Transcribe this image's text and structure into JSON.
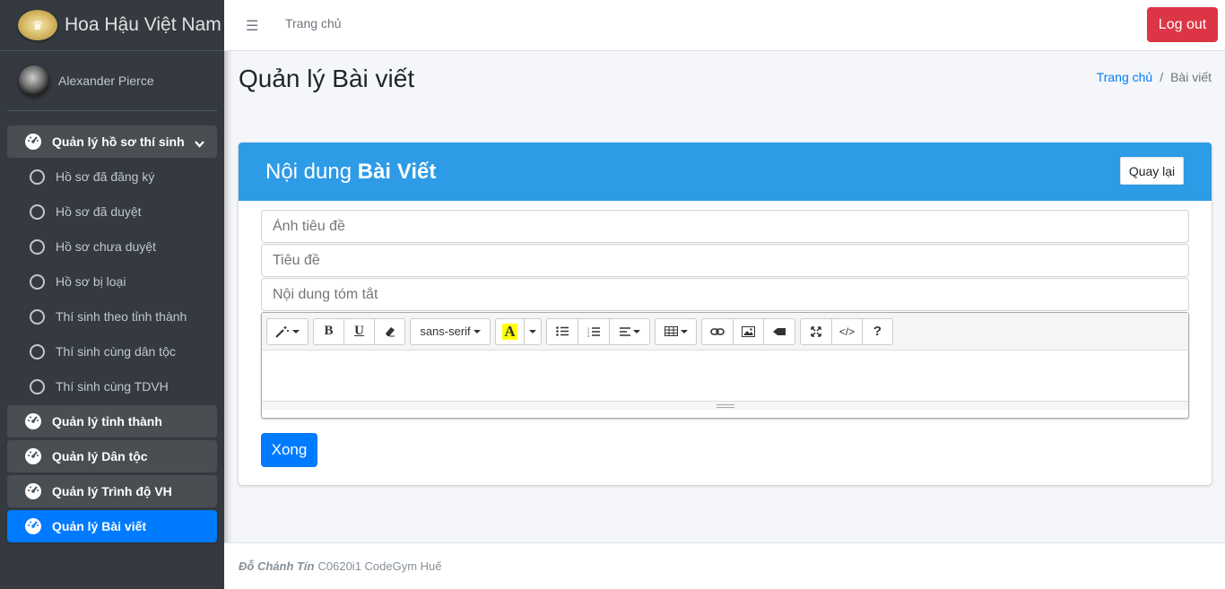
{
  "brand": {
    "name": "Hoa Hậu Việt Nam"
  },
  "user": {
    "name": "Alexander Pierce"
  },
  "sidebar": {
    "items": [
      {
        "label": "Quản lý hồ sơ thí sinh",
        "type": "parent",
        "expanded": true
      },
      {
        "label": "Hồ sơ đã đăng ký",
        "type": "sub"
      },
      {
        "label": "Hồ sơ đã duyệt",
        "type": "sub"
      },
      {
        "label": "Hồ sơ chưa duyệt",
        "type": "sub"
      },
      {
        "label": "Hồ sơ bị loại",
        "type": "sub"
      },
      {
        "label": "Thí sinh theo tỉnh thành",
        "type": "sub"
      },
      {
        "label": "Thí sinh cùng dân tộc",
        "type": "sub"
      },
      {
        "label": "Thí sinh cùng TDVH",
        "type": "sub"
      },
      {
        "label": "Quản lý tỉnh thành",
        "type": "parent"
      },
      {
        "label": "Quản lý Dân tộc",
        "type": "parent"
      },
      {
        "label": "Quản lý Trình độ VH",
        "type": "parent"
      },
      {
        "label": "Quản lý Bài viết",
        "type": "active"
      }
    ]
  },
  "topbar": {
    "home_link": "Trang chủ",
    "logout_label": "Log out"
  },
  "header": {
    "title": "Quản lý Bài viết",
    "breadcrumb": {
      "home": "Trang chủ",
      "separator": "/",
      "current": "Bài viết"
    }
  },
  "card": {
    "title_prefix": "Nội dung",
    "title_bold": "Bài Viết",
    "back_label": "Quay lại",
    "fields": {
      "image_placeholder": "Ảnh tiêu đề",
      "title_placeholder": "Tiêu đề",
      "summary_placeholder": "Nội dung tóm tắt"
    },
    "editor": {
      "font_name": "sans-serif"
    },
    "submit_label": "Xong"
  },
  "footer": {
    "author": "Đỗ Chánh Tín",
    "text": "C0620i1 CodeGym Huế"
  },
  "colors": {
    "sidebar_bg": "#343a40",
    "active_blue": "#007bff",
    "card_header": "#2d9be6",
    "logout_red": "#dc3545"
  }
}
